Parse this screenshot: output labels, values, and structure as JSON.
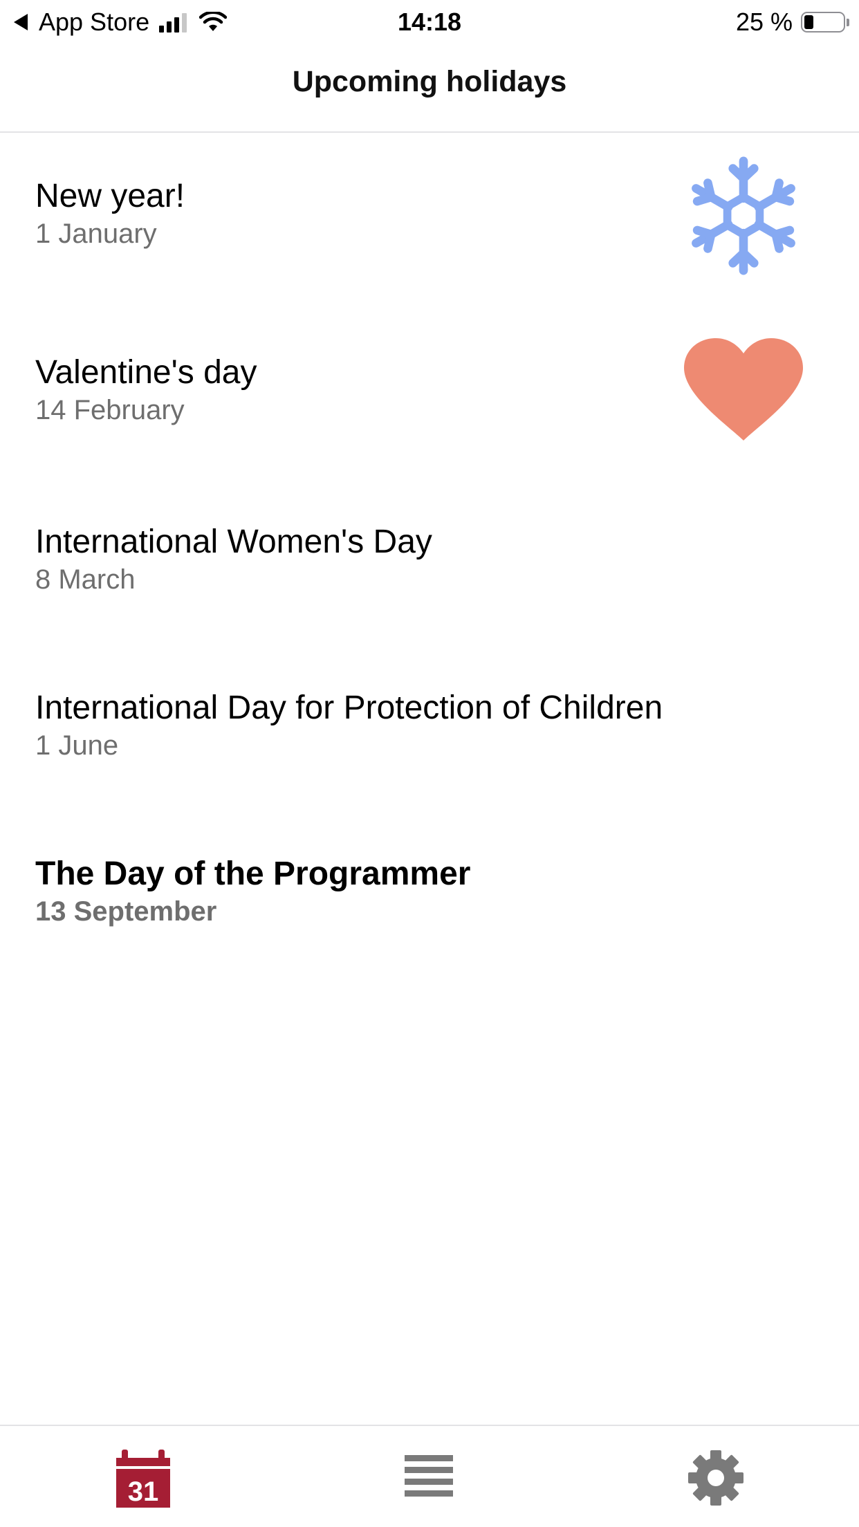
{
  "status_bar": {
    "back_label": "App Store",
    "time": "14:18",
    "battery_text": "25 %"
  },
  "nav": {
    "title": "Upcoming holidays"
  },
  "holidays": [
    {
      "title": "New year!",
      "date": "1 January",
      "icon": "snowflake-icon",
      "icon_color": "#86a9f2"
    },
    {
      "title": "Valentine's day",
      "date": "14 February",
      "icon": "heart-icon",
      "icon_color": "#ee8a72"
    },
    {
      "title": "International Women's Day",
      "date": "8 March"
    },
    {
      "title": "International Day for Protection of Children",
      "date": "1 June"
    },
    {
      "title": "The Day of the Programmer",
      "date": "13 September",
      "highlighted": true
    }
  ],
  "tab_bar": {
    "calendar_day": "31",
    "tabs": [
      {
        "icon": "calendar-icon",
        "active": true,
        "color": "#a51e34"
      },
      {
        "icon": "list-icon",
        "active": false,
        "color": "#7a7a7a"
      },
      {
        "icon": "gear-icon",
        "active": false,
        "color": "#7a7a7a"
      }
    ]
  }
}
